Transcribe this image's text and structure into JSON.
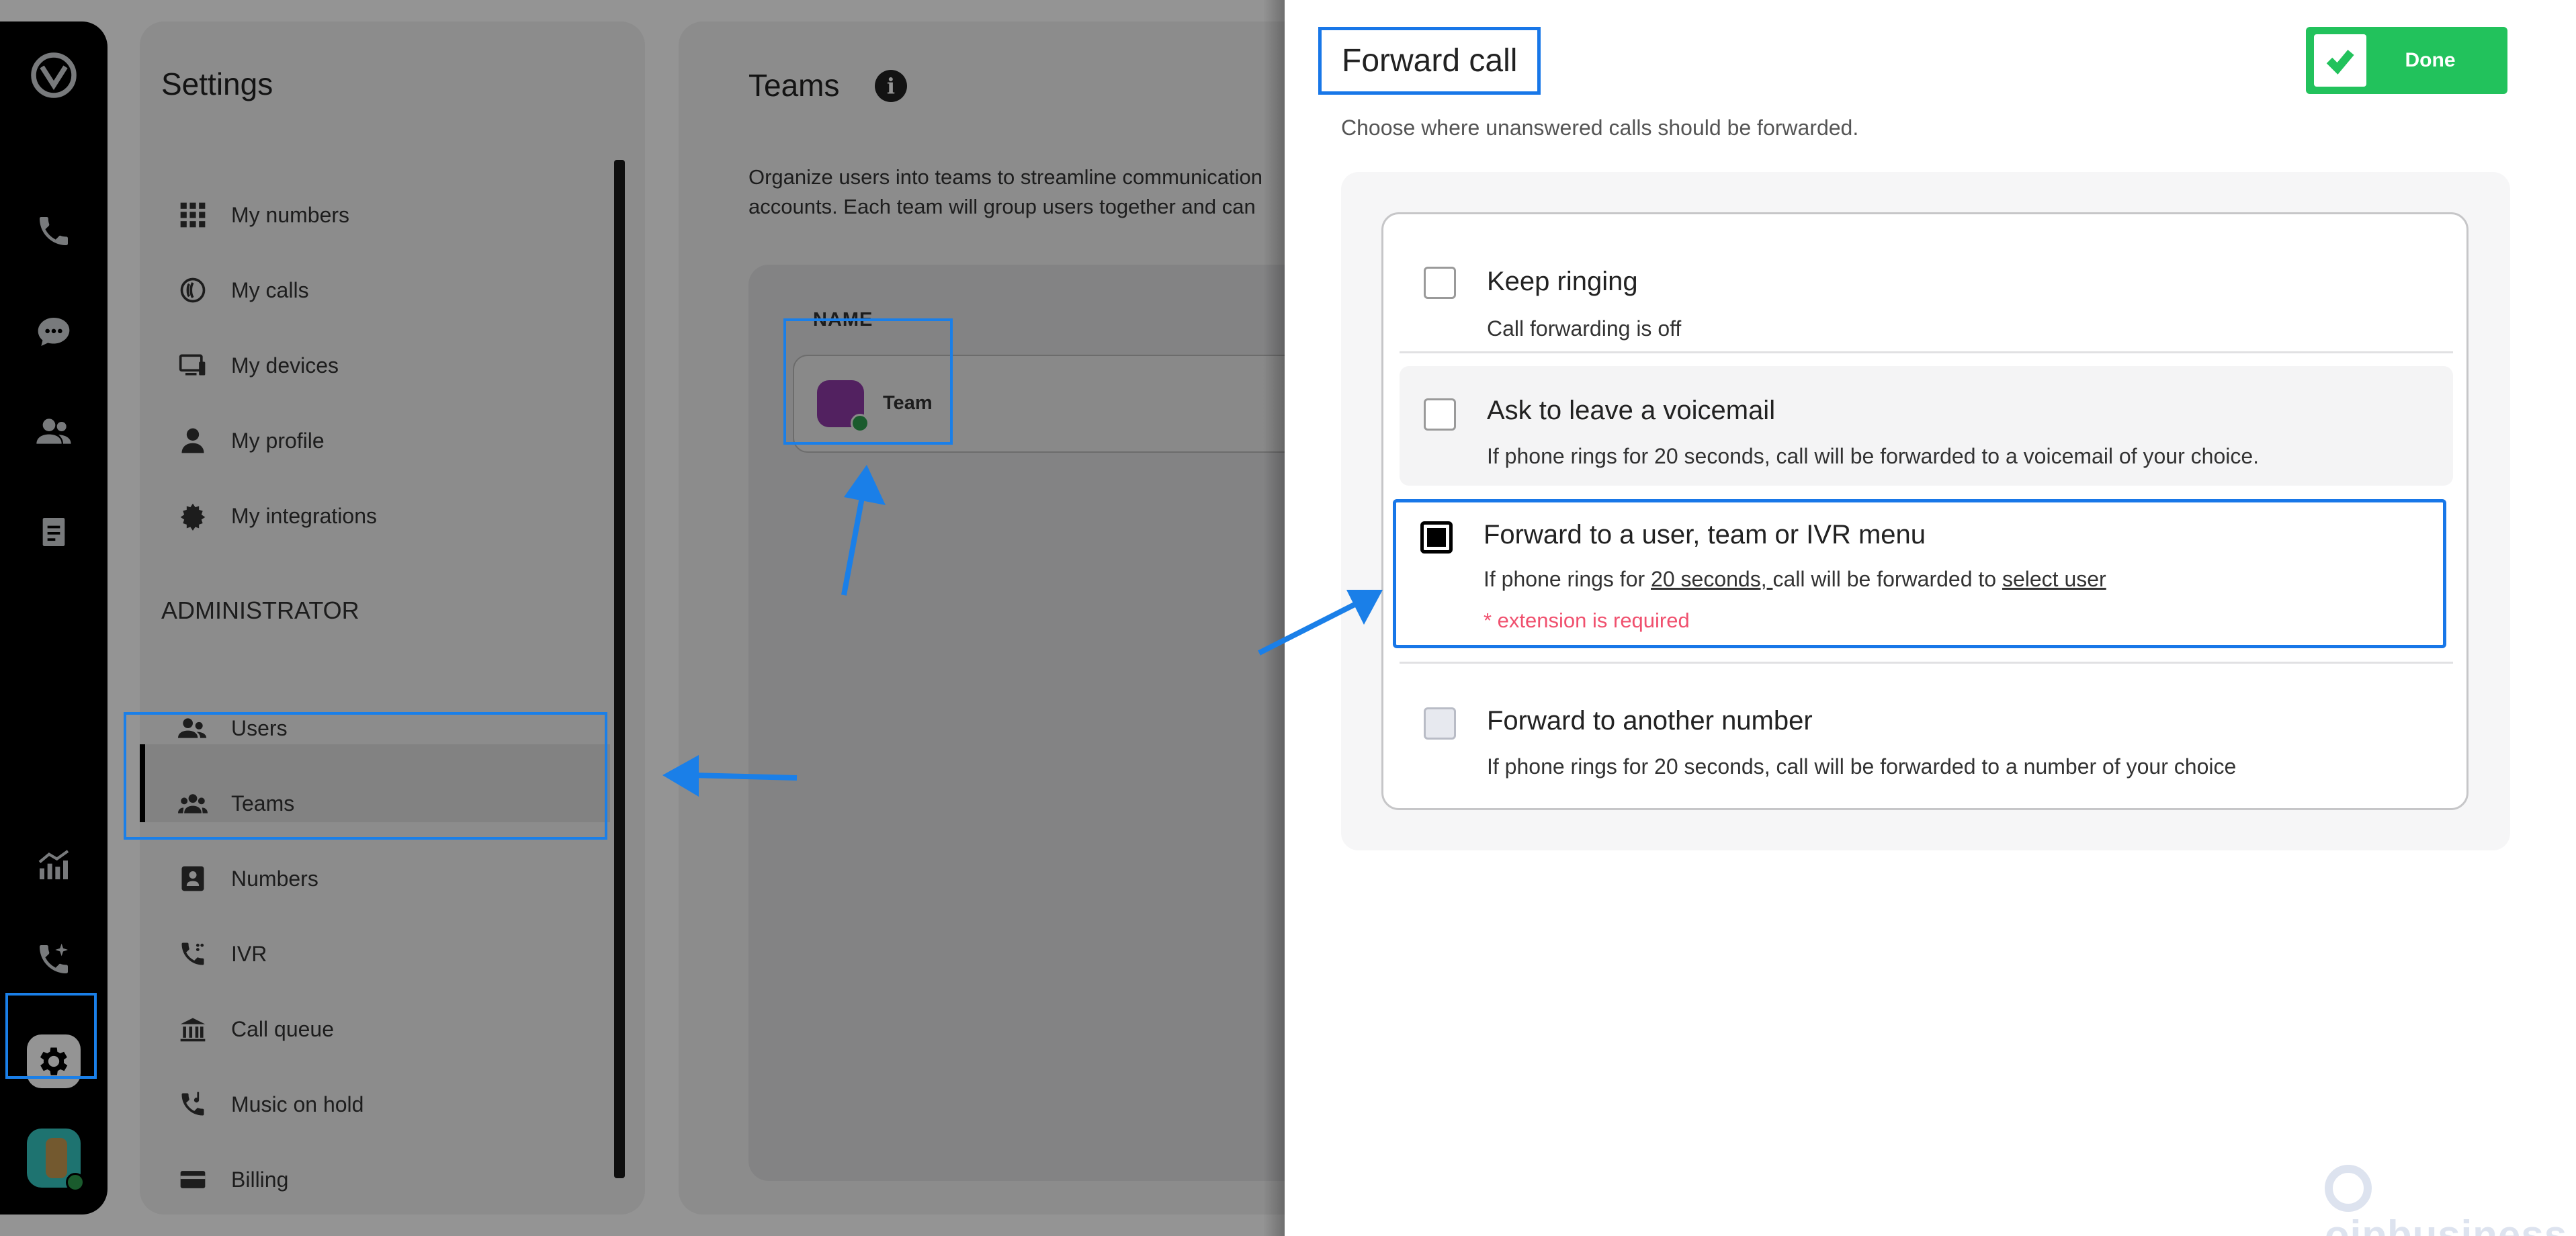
{
  "rail": {
    "items": [
      "logo-icon",
      "phone-icon",
      "chat-icon",
      "contacts-icon",
      "notes-icon",
      "analytics-icon",
      "call-ai-icon",
      "settings-icon",
      "avatar"
    ]
  },
  "settings": {
    "title": "Settings",
    "personal_items": [
      {
        "label": "My numbers",
        "icon": "grid-icon"
      },
      {
        "label": "My calls",
        "icon": "calls-icon"
      },
      {
        "label": "My devices",
        "icon": "devices-icon"
      },
      {
        "label": "My profile",
        "icon": "profile-icon"
      },
      {
        "label": "My integrations",
        "icon": "integrations-icon"
      }
    ],
    "admin_label": "ADMINISTRATOR",
    "admin_items": [
      {
        "label": "Users",
        "icon": "users-icon"
      },
      {
        "label": "Teams",
        "icon": "teams-icon"
      },
      {
        "label": "Numbers",
        "icon": "numbers-icon"
      },
      {
        "label": "IVR",
        "icon": "ivr-icon"
      },
      {
        "label": "Call queue",
        "icon": "call-queue-icon"
      },
      {
        "label": "Music on hold",
        "icon": "music-icon"
      },
      {
        "label": "Billing",
        "icon": "billing-icon"
      }
    ],
    "active_item": "Teams"
  },
  "teams": {
    "title": "Teams",
    "description_line1": "Organize users into teams to streamline communication",
    "description_line2": "accounts. Each team will group users together and can",
    "column_header": "NAME",
    "rows": [
      {
        "name": "Team"
      }
    ]
  },
  "forward_call": {
    "title": "Forward call",
    "done_label": "Done",
    "subtitle": "Choose where unanswered calls should be forwarded.",
    "options": [
      {
        "title": "Keep ringing",
        "desc": "Call forwarding is off",
        "checked": false
      },
      {
        "title": "Ask to leave a voicemail",
        "desc": "If phone rings for 20 seconds, call will be forwarded to a voicemail of your choice.",
        "checked": false
      },
      {
        "title": "Forward to a user, team or IVR menu",
        "desc_prefix": "If phone rings for ",
        "desc_seconds": "20 seconds, ",
        "desc_middle": "call will be forwarded to ",
        "desc_link": "select user",
        "error": "* extension is required",
        "checked": true
      },
      {
        "title": "Forward to another number",
        "desc": "If phone rings for 20 seconds, call will be forwarded to a number of your choice",
        "checked": false
      }
    ]
  },
  "watermark": {
    "text": "oipbusiness"
  },
  "colors": {
    "accent": "#1877e8",
    "done": "#22c25c",
    "error": "#f0506e"
  }
}
